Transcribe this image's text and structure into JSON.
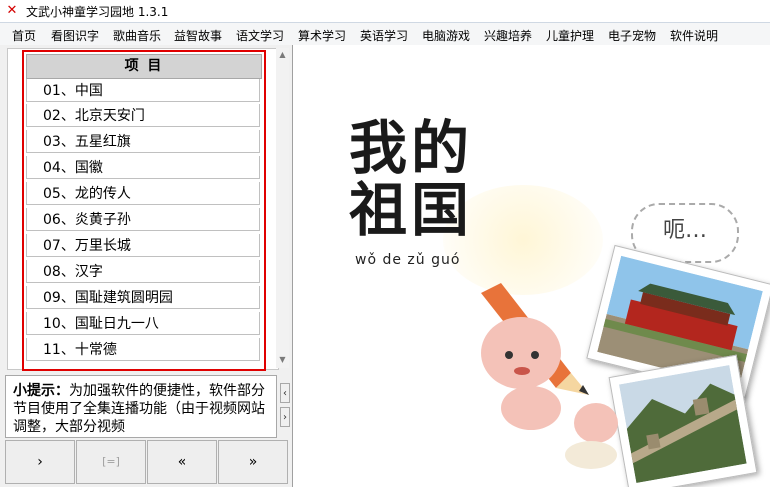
{
  "window": {
    "title": "文武小神童学习园地 1.3.1",
    "icon": "app-logo-icon"
  },
  "menu": [
    "首页",
    "看图识字",
    "歌曲音乐",
    "益智故事",
    "语文学习",
    "算术学习",
    "英语学习",
    "电脑游戏",
    "兴趣培养",
    "儿童护理",
    "电子宠物",
    "软件说明"
  ],
  "list": {
    "header": "项 目",
    "items": [
      "01、中国",
      "02、北京天安门",
      "03、五星红旗",
      "04、国徽",
      "05、龙的传人",
      "06、炎黄子孙",
      "07、万里长城",
      "08、汉字",
      "09、国耻建筑圆明园",
      "10、国耻日九一八",
      "11、十常德"
    ]
  },
  "tip": {
    "label": "小提示：",
    "text": "为加强软件的便捷性，软件部分节目使用了全集连播功能（由于视频网站调整，大部分视频"
  },
  "buttons": {
    "play": "›",
    "stop": "[=]",
    "prev": "«",
    "next": "»"
  },
  "content": {
    "title_line1": "我的",
    "title_line2": "祖国",
    "pinyin": "wǒ de zǔ guó",
    "speech": "呃…"
  },
  "colors": {
    "highlight_border": "#e00000",
    "list_header_bg": "#d3d3d3"
  }
}
